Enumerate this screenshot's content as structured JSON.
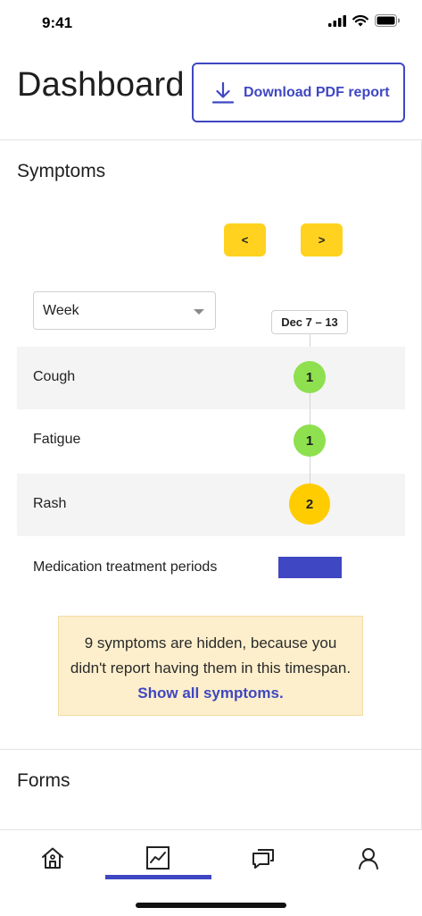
{
  "status_bar": {
    "time": "9:41"
  },
  "header": {
    "title": "Dashboard",
    "download_label": "Download PDF report"
  },
  "symptoms": {
    "title": "Symptoms",
    "prev_label": "<",
    "next_label": ">",
    "period": {
      "selected": "Week"
    },
    "week_label": "Dec 7 – 13",
    "rows": [
      {
        "name": "Cough",
        "count": "1",
        "severity_color": "#8ee04f"
      },
      {
        "name": "Fatigue",
        "count": "1",
        "severity_color": "#8ee04f"
      },
      {
        "name": "Rash",
        "count": "2",
        "severity_color": "#ffcc00"
      }
    ],
    "medication": {
      "label": "Medication treatment periods",
      "color": "#3f47c2"
    },
    "hidden_notice": {
      "text": "9 symptoms are hidden, because you didn't report having them in this timespan.",
      "link": "Show all symptoms."
    }
  },
  "forms": {
    "title": "Forms"
  },
  "bottom_nav": {
    "items": [
      {
        "icon": "home-icon",
        "active": false
      },
      {
        "icon": "chart-icon",
        "active": true
      },
      {
        "icon": "chat-icon",
        "active": false
      },
      {
        "icon": "profile-icon",
        "active": false
      }
    ],
    "accent": "#3f47c2"
  }
}
